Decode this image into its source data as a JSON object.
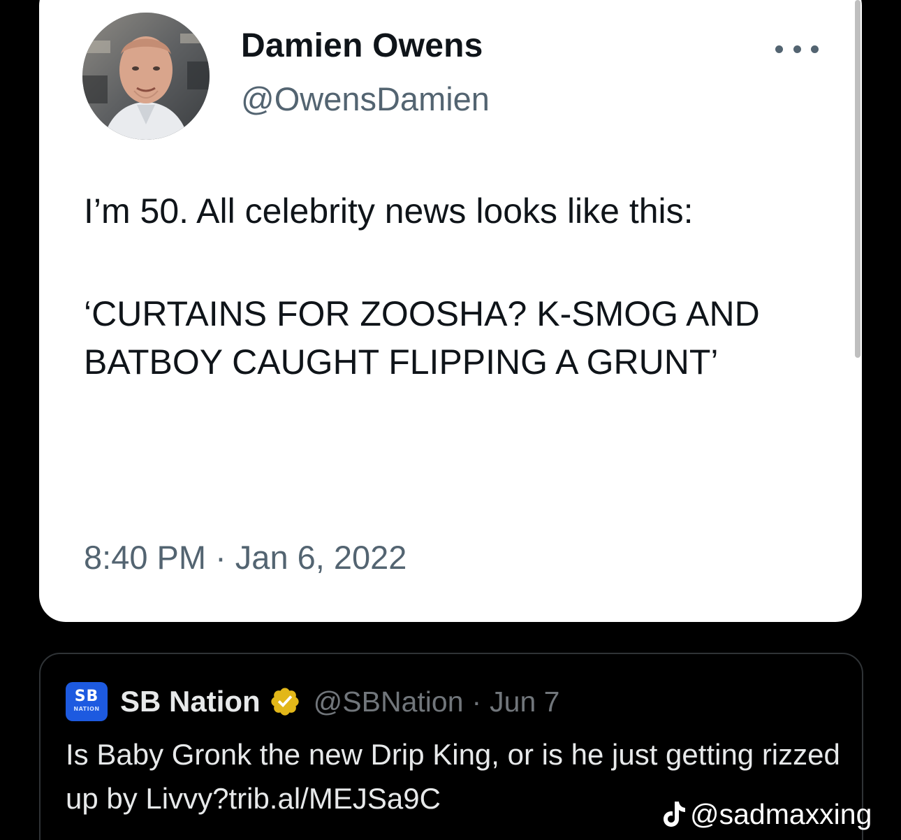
{
  "tweet": {
    "author_name": "Damien Owens",
    "author_handle": "@OwensDamien",
    "more_icon": "more-horizontal-icon",
    "text_line1": "I’m 50. All celebrity news looks like this:",
    "text_line2": "‘CURTAINS FOR ZOOSHA? K-SMOG AND BATBOY CAUGHT FLIPPING A GRUNT’",
    "timestamp": "8:40 PM · Jan 6, 2022"
  },
  "quoted_tweet": {
    "logo_text": "SB",
    "logo_subtext": "NATION",
    "name": "SB Nation",
    "verified_icon": "verified-badge-icon",
    "handle": "@SBNation",
    "separator": "·",
    "date": "Jun 7",
    "text": "Is Baby Gronk the new Drip King, or is he just getting rizzed up by Livvy?trib.al/MEJSa9C"
  },
  "watermark": {
    "icon": "tiktok-icon",
    "text": "@sadmaxxing"
  },
  "colors": {
    "background": "#000000",
    "card": "#ffffff",
    "primary_text": "#0f1419",
    "secondary_text": "#536471",
    "dark_text": "#e7e9ea",
    "dark_secondary": "#71767b",
    "verified_gold": "#e2b719",
    "sb_blue": "#1d5ae0"
  }
}
